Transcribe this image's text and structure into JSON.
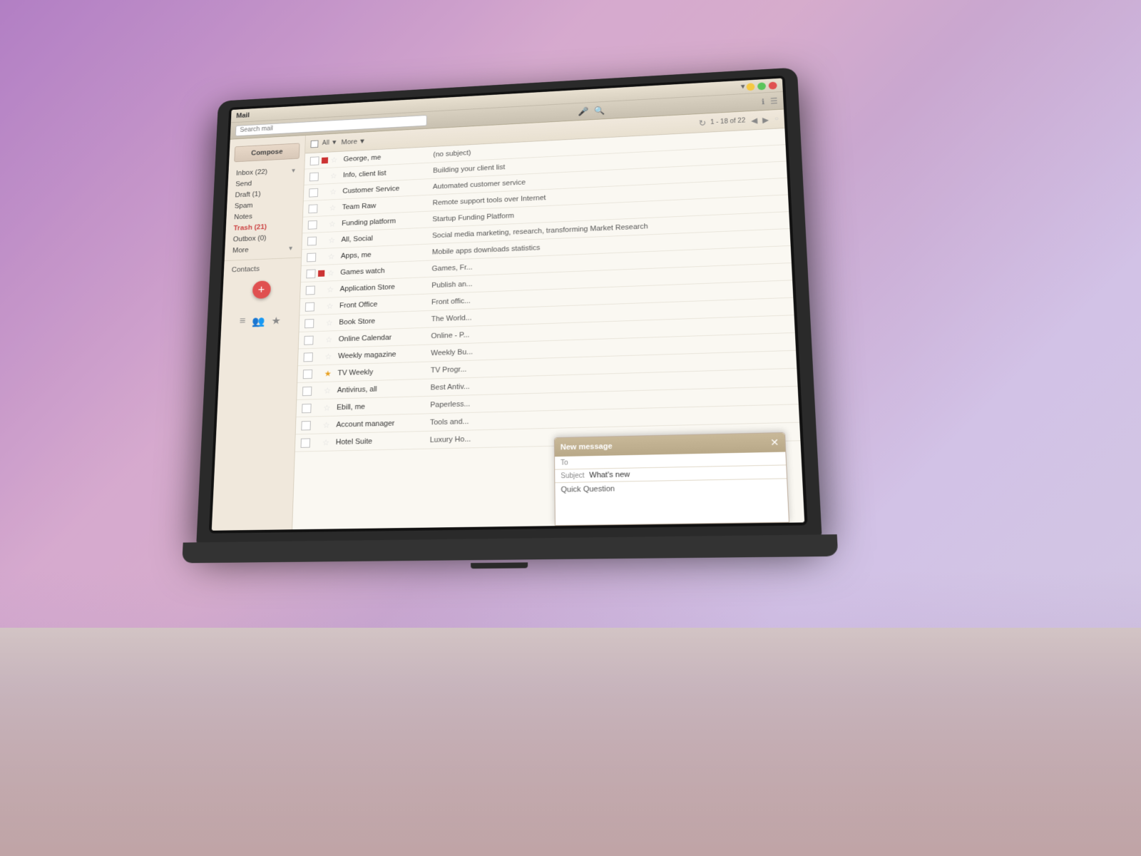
{
  "window": {
    "title": "Mail",
    "search_placeholder": "Search mail",
    "minimize": "−",
    "maximize": "□",
    "close": "✕"
  },
  "toolbar": {
    "all_label": "All",
    "more_label": "More",
    "pagination": "1 - 18 of 22",
    "refresh_icon": "↻"
  },
  "sidebar": {
    "compose_label": "Compose",
    "items": [
      {
        "label": "Inbox (22)",
        "id": "inbox",
        "active": false,
        "badge": "22"
      },
      {
        "label": "Send",
        "id": "send",
        "active": false
      },
      {
        "label": "Draft (1)",
        "id": "draft",
        "active": false
      },
      {
        "label": "Spam",
        "id": "spam",
        "active": false
      },
      {
        "label": "Notes",
        "id": "notes",
        "active": false
      },
      {
        "label": "Trash (21)",
        "id": "trash",
        "active": true
      },
      {
        "label": "Outbox (0)",
        "id": "outbox",
        "active": false
      },
      {
        "label": "More",
        "id": "more",
        "active": false
      }
    ],
    "contacts_label": "Contacts",
    "fab_icon": "+"
  },
  "emails": [
    {
      "id": 1,
      "sender": "George, me",
      "subject": "(no subject)",
      "starred": false,
      "important": true,
      "unread": false
    },
    {
      "id": 2,
      "sender": "Info, client list",
      "subject": "Building your client list",
      "starred": false,
      "important": false,
      "unread": false
    },
    {
      "id": 3,
      "sender": "Customer Service",
      "subject": "Automated customer service",
      "starred": false,
      "important": false,
      "unread": false
    },
    {
      "id": 4,
      "sender": "Team Raw",
      "subject": "Remote support tools over Internet",
      "starred": false,
      "important": false,
      "unread": false
    },
    {
      "id": 5,
      "sender": "Funding platform",
      "subject": "Startup Funding Platform",
      "starred": false,
      "important": false,
      "unread": false
    },
    {
      "id": 6,
      "sender": "All, Social",
      "subject": "Social media marketing, research, transforming Market Research",
      "starred": false,
      "important": false,
      "unread": false
    },
    {
      "id": 7,
      "sender": "Apps, me",
      "subject": "Mobile apps downloads statistics",
      "starred": false,
      "important": false,
      "unread": false
    },
    {
      "id": 8,
      "sender": "Games watch",
      "subject": "Games, Fr...",
      "starred": false,
      "important": true,
      "unread": false
    },
    {
      "id": 9,
      "sender": "Application Store",
      "subject": "Publish an...",
      "starred": false,
      "important": false,
      "unread": false
    },
    {
      "id": 10,
      "sender": "Front Office",
      "subject": "Front offic...",
      "starred": false,
      "important": false,
      "unread": false
    },
    {
      "id": 11,
      "sender": "Book Store",
      "subject": "The World...",
      "starred": false,
      "important": false,
      "unread": false
    },
    {
      "id": 12,
      "sender": "Online Calendar",
      "subject": "Online - P...",
      "starred": false,
      "important": false,
      "unread": false
    },
    {
      "id": 13,
      "sender": "Weekly magazine",
      "subject": "Weekly Bu...",
      "starred": false,
      "important": false,
      "unread": false
    },
    {
      "id": 14,
      "sender": "TV Weekly",
      "subject": "TV Progr...",
      "starred": true,
      "important": false,
      "unread": false
    },
    {
      "id": 15,
      "sender": "Antivirus, all",
      "subject": "Best Antiv...",
      "starred": false,
      "important": false,
      "unread": false
    },
    {
      "id": 16,
      "sender": "Ebill, me",
      "subject": "Paperless...",
      "starred": false,
      "important": false,
      "unread": false
    },
    {
      "id": 17,
      "sender": "Account manager",
      "subject": "Tools and...",
      "starred": false,
      "important": false,
      "unread": false
    },
    {
      "id": 18,
      "sender": "Hotel Suite",
      "subject": "Luxury Ho...",
      "starred": false,
      "important": false,
      "unread": false
    }
  ],
  "new_message": {
    "title": "New message",
    "to_label": "To",
    "to_value": "",
    "subject_label": "Subject",
    "subject_value": "What's new",
    "body_value": "Quick Question"
  }
}
